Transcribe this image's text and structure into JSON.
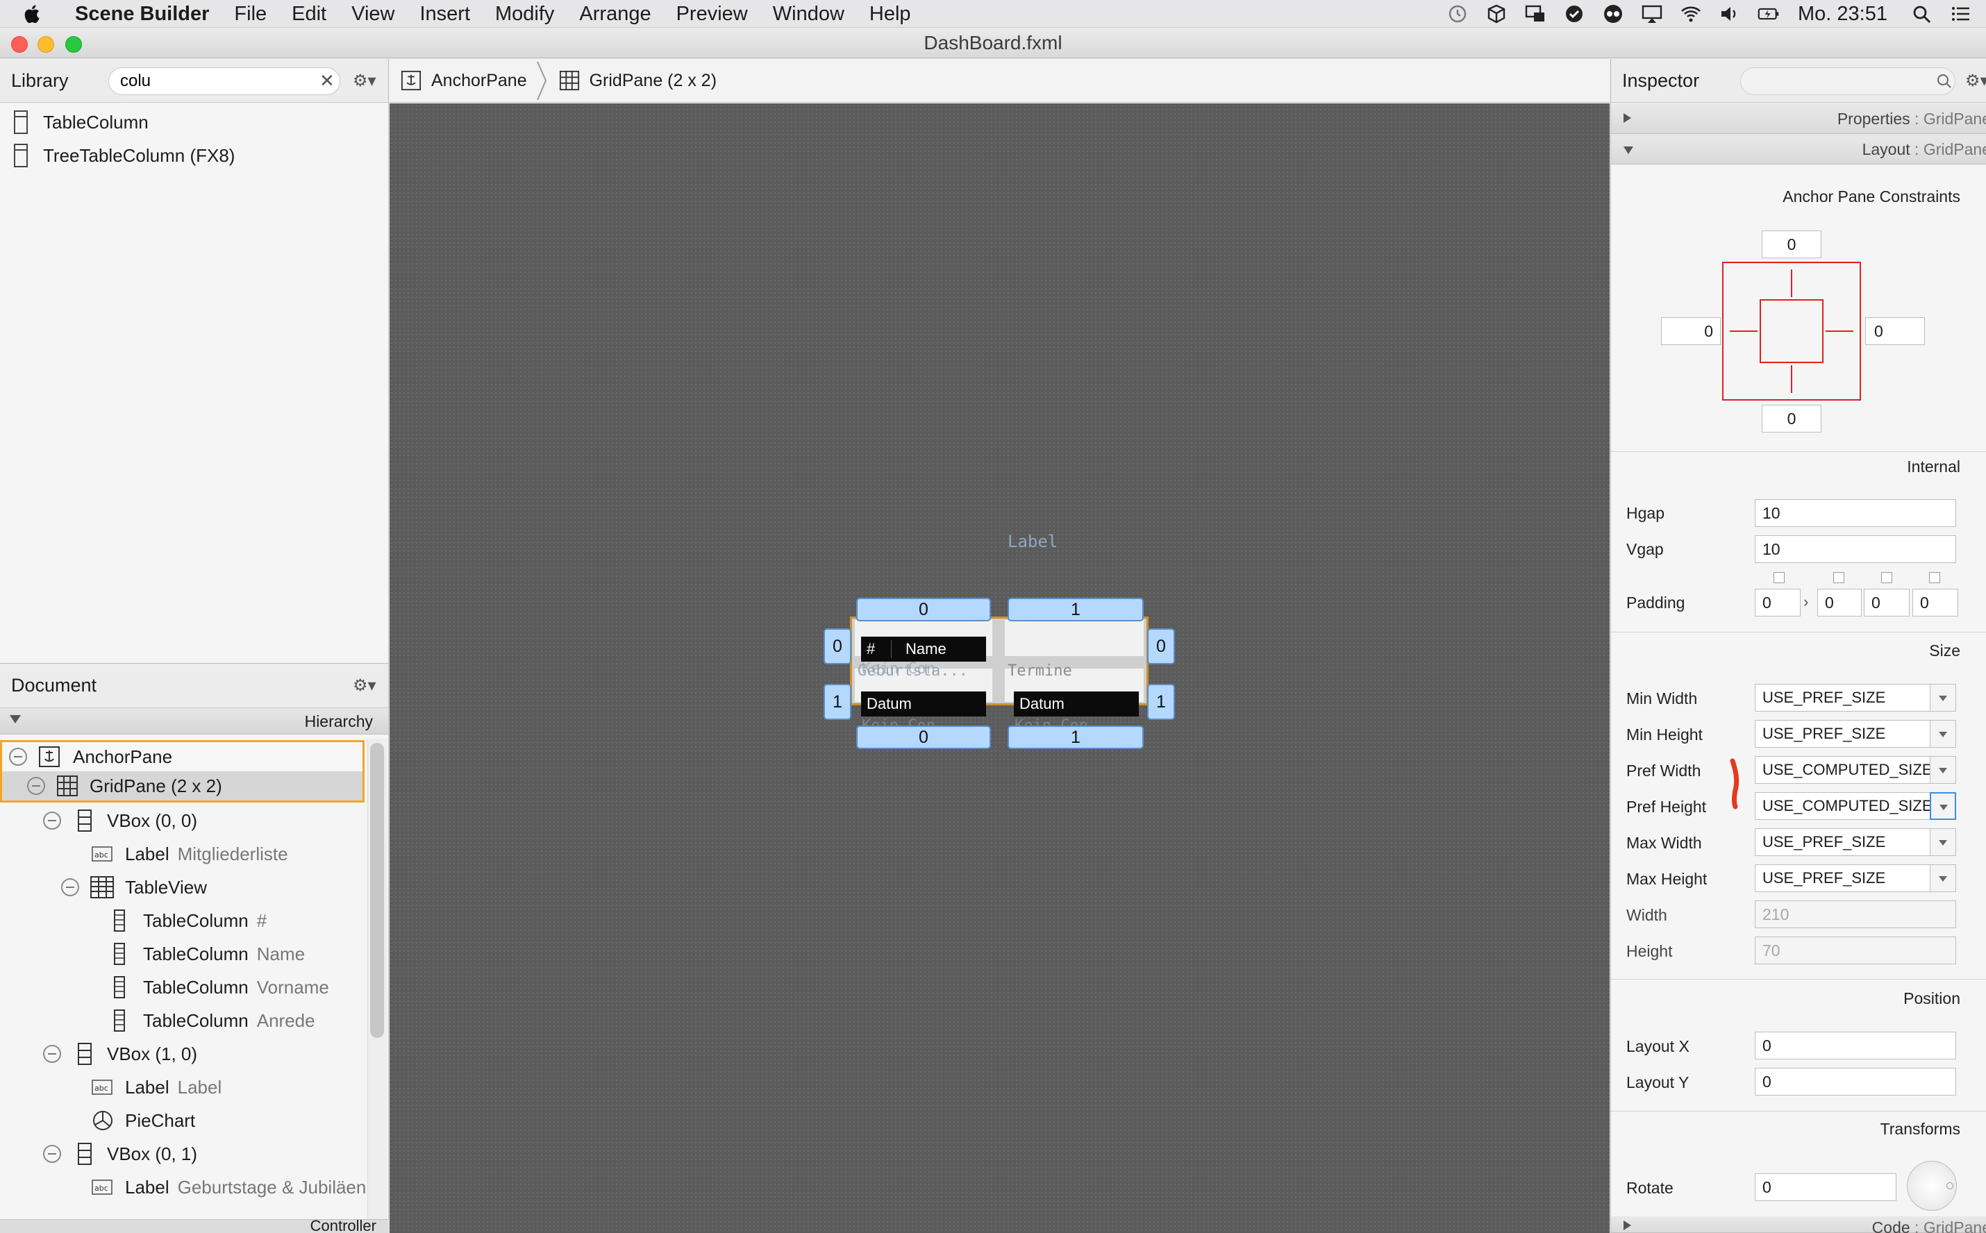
{
  "menubar": {
    "app_name": "Scene Builder",
    "items": [
      "File",
      "Edit",
      "View",
      "Insert",
      "Modify",
      "Arrange",
      "Preview",
      "Window",
      "Help"
    ],
    "clock": "Mo. 23:51"
  },
  "window": {
    "title": "DashBoard.fxml"
  },
  "library": {
    "title": "Library",
    "search_value": "colu",
    "items": [
      {
        "label": "TableColumn"
      },
      {
        "label": "TreeTableColumn  (FX8)"
      }
    ]
  },
  "document": {
    "title": "Document",
    "hierarchy_label": "Hierarchy",
    "controller_label": "Controller",
    "tree": [
      {
        "type": "AnchorPane",
        "sub": "",
        "icon": "anchorpane-icon"
      },
      {
        "type": "GridPane (2 x 2)",
        "sub": "",
        "icon": "gridpane-icon"
      },
      {
        "type": "VBox (0, 0)",
        "sub": "",
        "icon": "vbox-icon"
      },
      {
        "type": "Label",
        "sub": "Mitgliederliste",
        "icon": "label-icon"
      },
      {
        "type": "TableView",
        "sub": "",
        "icon": "tableview-icon"
      },
      {
        "type": "TableColumn",
        "sub": "#",
        "icon": "tablecolumn-icon"
      },
      {
        "type": "TableColumn",
        "sub": "Name",
        "icon": "tablecolumn-icon"
      },
      {
        "type": "TableColumn",
        "sub": "Vorname",
        "icon": "tablecolumn-icon"
      },
      {
        "type": "TableColumn",
        "sub": "Anrede",
        "icon": "tablecolumn-icon"
      },
      {
        "type": "VBox (1, 0)",
        "sub": "",
        "icon": "vbox-icon"
      },
      {
        "type": "Label",
        "sub": "Label",
        "icon": "label-icon"
      },
      {
        "type": "PieChart",
        "sub": "",
        "icon": "piechart-icon"
      },
      {
        "type": "VBox (0, 1)",
        "sub": "",
        "icon": "vbox-icon"
      },
      {
        "type": "Label",
        "sub": "Geburtstage & Jubiläen",
        "icon": "label-icon"
      }
    ]
  },
  "breadcrumb": [
    {
      "label": "AnchorPane",
      "icon": "anchorpane-icon"
    },
    {
      "label": "GridPane (2 x 2)",
      "icon": "gridpane-icon"
    }
  ],
  "canvas": {
    "label_text": "Label",
    "col_headers": [
      "0",
      "1"
    ],
    "row_headers": [
      "0",
      "1"
    ],
    "col_footers": [
      "0",
      "1"
    ],
    "row_right": [
      "0",
      "1"
    ],
    "table_header_1_hash": "#",
    "table_header_1_name": "Name",
    "ghost_birthday": "Geburtsta...",
    "ghost_kein": "Kein Con",
    "ghost_termine": "Termine",
    "datum_1": "Datum",
    "datum_2": "Datum",
    "ghost_kein_2": "Kein Con",
    "ghost_kein_3": "Kein Con"
  },
  "inspector": {
    "title": "Inspector",
    "properties_bar": {
      "name": "Properties",
      "sep": " : ",
      "target": "GridPane"
    },
    "layout_bar": {
      "name": "Layout",
      "sep": " : ",
      "target": "GridPane"
    },
    "code_bar": {
      "name": "Code",
      "sep": " : ",
      "target": "GridPane"
    },
    "anchor_title": "Anchor Pane Constraints",
    "anchor": {
      "top": "0",
      "left": "0",
      "right": "0",
      "bottom": "0"
    },
    "internal_title": "Internal",
    "hgap_label": "Hgap",
    "hgap": "10",
    "vgap_label": "Vgap",
    "vgap": "10",
    "padding_label": "Padding",
    "padding": [
      "0",
      "0",
      "0",
      "0"
    ],
    "size_title": "Size",
    "size_rows": [
      {
        "label": "Min Width",
        "value": "USE_PREF_SIZE"
      },
      {
        "label": "Min Height",
        "value": "USE_PREF_SIZE"
      },
      {
        "label": "Pref Width",
        "value": "USE_COMPUTED_SIZE"
      },
      {
        "label": "Pref Height",
        "value": "USE_COMPUTED_SIZE"
      },
      {
        "label": "Max Width",
        "value": "USE_PREF_SIZE"
      },
      {
        "label": "Max Height",
        "value": "USE_PREF_SIZE"
      }
    ],
    "width_label": "Width",
    "width": "210",
    "height_label": "Height",
    "height": "70",
    "position_title": "Position",
    "layout_x_label": "Layout X",
    "layout_x": "0",
    "layout_y_label": "Layout Y",
    "layout_y": "0",
    "transforms_title": "Transforms",
    "rotate_label": "Rotate",
    "rotate": "0"
  },
  "colors": {
    "selection_orange": "#f3a626",
    "gutter_blue": "#b5d8ff",
    "anchor_red": "#e02020",
    "annotation_red": "#e23b1e"
  }
}
